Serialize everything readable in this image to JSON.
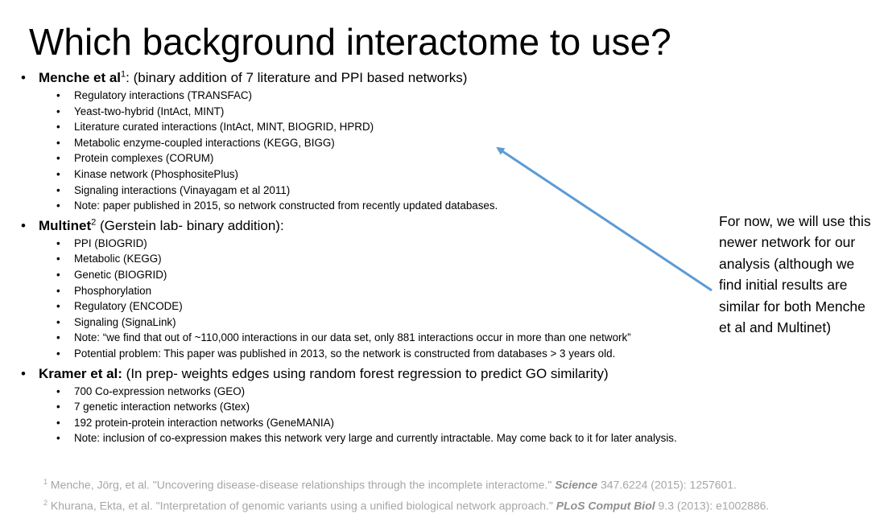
{
  "slide": {
    "title": "Which background interactome to use?",
    "sections": [
      {
        "name": "Menche et al",
        "sup": "1",
        "desc": ": (binary addition of 7 literature and PPI based networks)",
        "items": [
          "Regulatory interactions (TRANSFAC)",
          "Yeast-two-hybrid (IntAct, MINT)",
          "Literature curated interactions (IntAct, MINT, BIOGRID, HPRD)",
          "Metabolic enzyme-coupled interactions (KEGG, BIGG)",
          "Protein complexes (CORUM)",
          "Kinase network (PhosphositePlus)",
          "Signaling interactions (Vinayagam et al 2011)",
          "Note: paper published in 2015, so network constructed from recently updated databases."
        ]
      },
      {
        "name": "Multinet",
        "sup": "2",
        "desc": " (Gerstein lab- binary addition):",
        "items": [
          "PPI (BIOGRID)",
          "Metabolic (KEGG)",
          "Genetic (BIOGRID)",
          "Phosphorylation",
          "Regulatory (ENCODE)",
          "Signaling (SignaLink)",
          "Note: “we find that out of ~110,000 interactions in our data set, only 881 interactions occur in more than one network”",
          "Potential problem: This paper was published in 2013, so the network is constructed from databases > 3 years old."
        ]
      },
      {
        "name": "Kramer et al:",
        "sup": "",
        "desc": " (In prep- weights edges using random forest regression to predict GO similarity)",
        "items": [
          "700 Co-expression networks (GEO)",
          "7 genetic interaction networks (Gtex)",
          "192 protein-protein interaction networks (GeneMANIA)",
          "Note: inclusion of co-expression makes this network very large and currently intractable.  May come back to it for later analysis."
        ]
      }
    ],
    "callout": "For now, we will use this newer network for our analysis (although we find initial results are similar for both Menche et al and Multinet)",
    "arrow_color": "#5b9bd5",
    "footnotes": [
      {
        "num": "1",
        "text": " Menche, Jörg, et al. \"Uncovering disease-disease relationships through the incomplete interactome.\" ",
        "journal": "Science",
        "tail": " 347.6224 (2015): 1257601."
      },
      {
        "num": "2",
        "text": " Khurana, Ekta, et al. \"Interpretation of genomic variants using a unified biological network approach.\" ",
        "journal": "PLoS Comput Biol",
        "tail": " 9.3 (2013): e1002886."
      }
    ]
  }
}
